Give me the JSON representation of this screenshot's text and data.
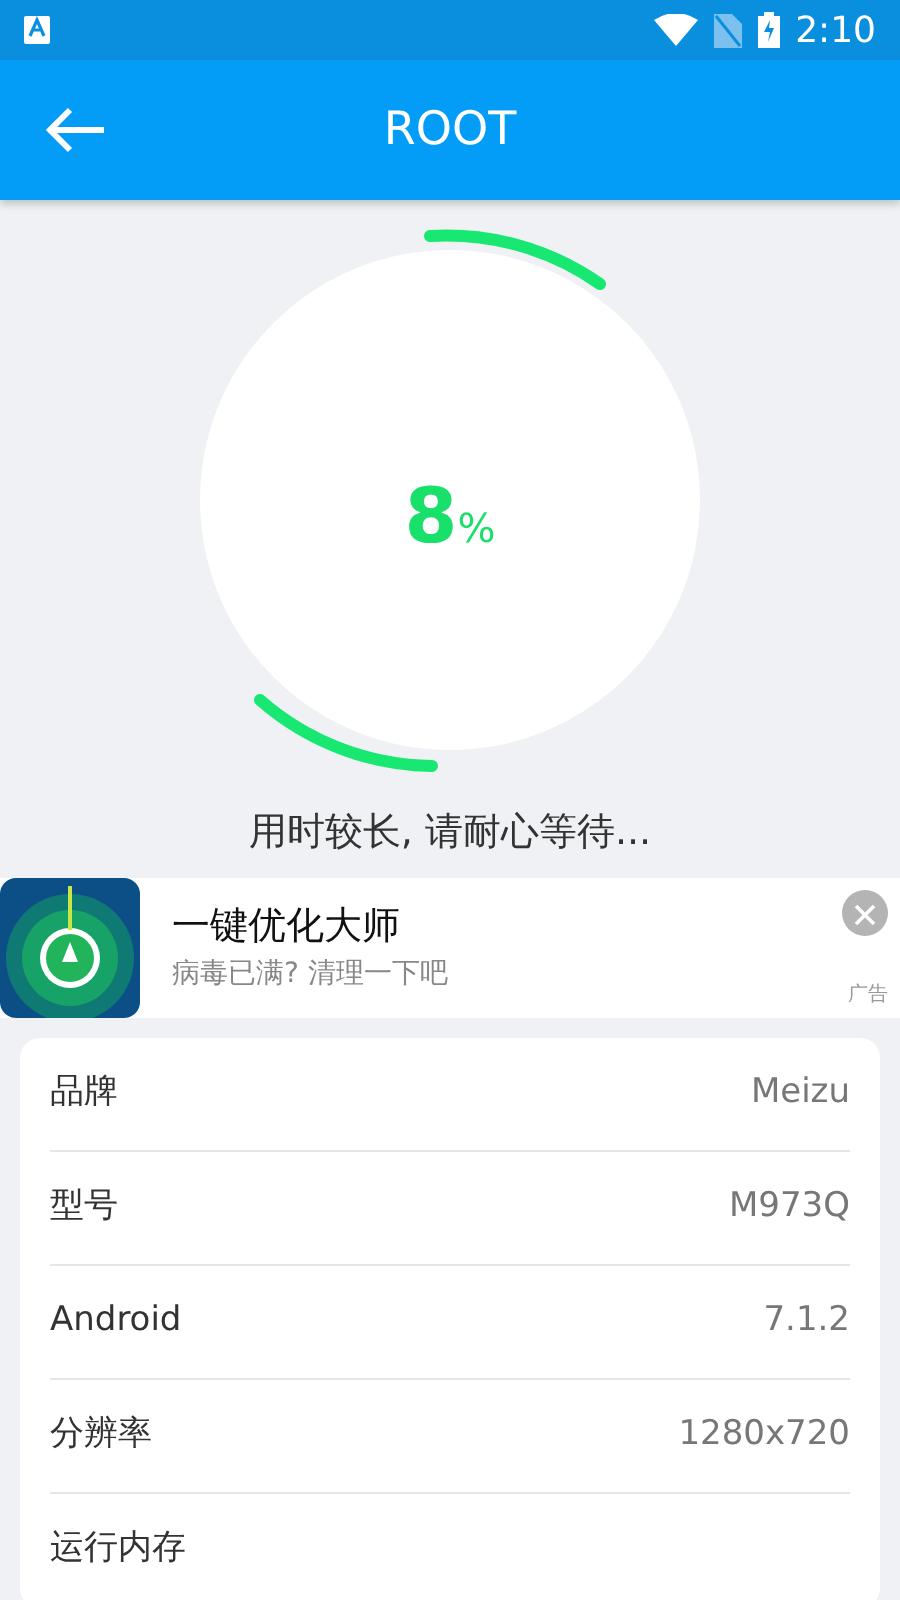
{
  "status_bar": {
    "time": "2:10"
  },
  "app_bar": {
    "title": "ROOT"
  },
  "progress": {
    "value": "8",
    "unit": "%",
    "message": "用时较长, 请耐心等待..."
  },
  "ad": {
    "title": "一键优化大师",
    "subtitle": "病毒已满? 清理一下吧",
    "tag": "广告"
  },
  "info_rows": [
    {
      "label": "品牌",
      "value": "Meizu"
    },
    {
      "label": "型号",
      "value": "M973Q"
    },
    {
      "label": "Android",
      "value": "7.1.2"
    },
    {
      "label": "分辨率",
      "value": "1280x720"
    },
    {
      "label": "运行内存"
    }
  ]
}
